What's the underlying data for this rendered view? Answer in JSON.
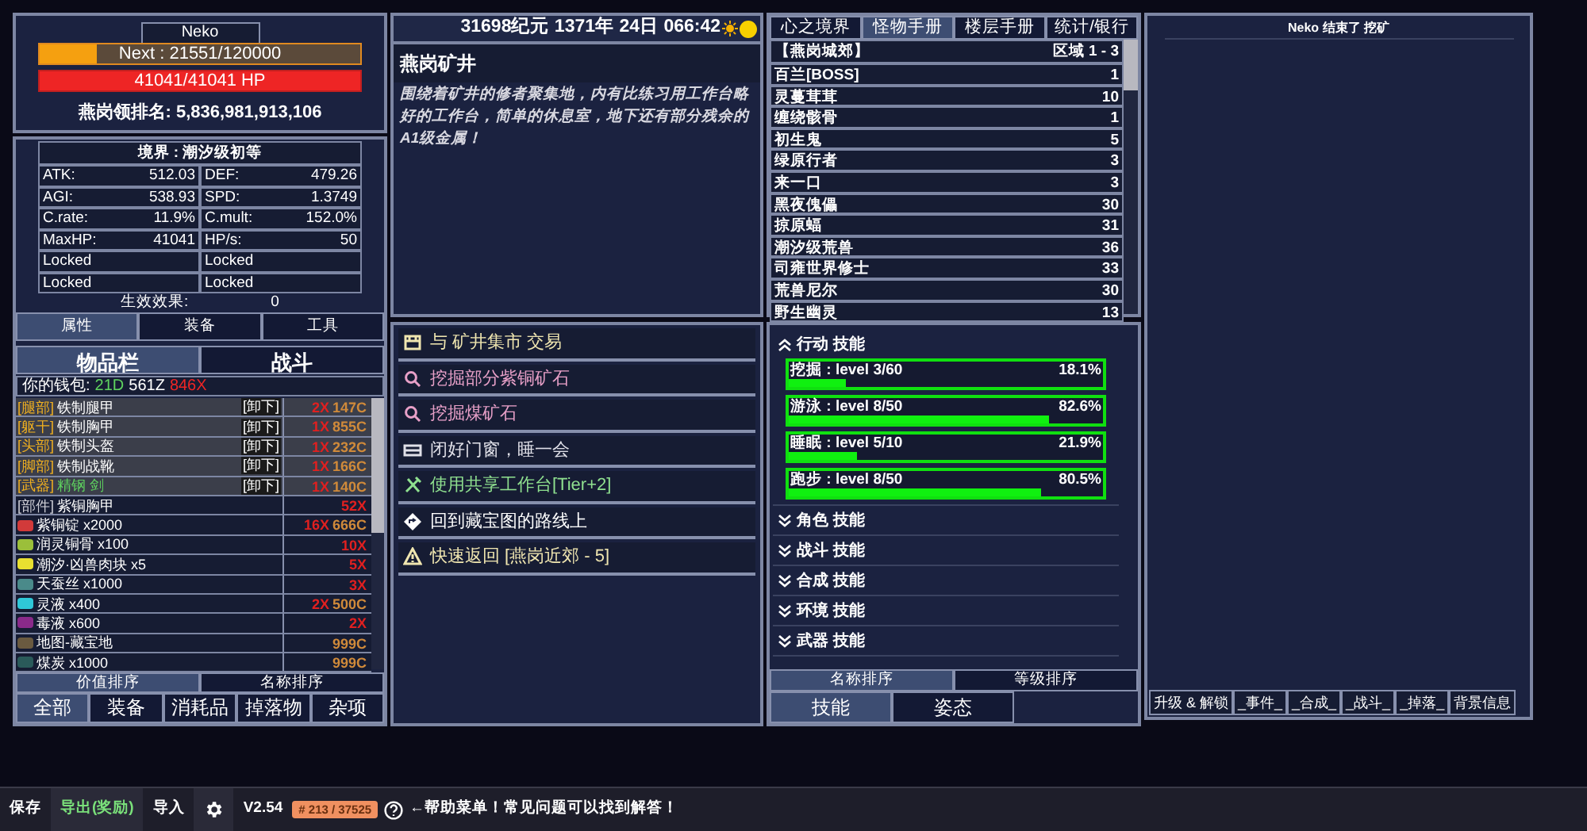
{
  "character": {
    "name": "Neko",
    "exp": {
      "text": "Next : 21551/120000",
      "level": 0.18
    },
    "hp": {
      "text": "41041/41041 HP",
      "level": 1
    },
    "rank": "燕岗领排名: 5,836,981,913,106"
  },
  "stats": {
    "realm": "境界 : 潮汐级初等",
    "cells": [
      {
        "label": "ATK:",
        "value": "512.03"
      },
      {
        "label": "DEF:",
        "value": "479.26"
      },
      {
        "label": "AGI:",
        "value": "538.93"
      },
      {
        "label": "SPD:",
        "value": "1.3749"
      },
      {
        "label": "C.rate:",
        "value": "11.9%"
      },
      {
        "label": "C.mult:",
        "value": "152.0%"
      },
      {
        "label": "MaxHP:",
        "value": "41041"
      },
      {
        "label": "HP/s:",
        "value": "50"
      },
      {
        "label": "Locked"
      },
      {
        "label": "Locked"
      },
      {
        "label": "Locked"
      },
      {
        "label": "Locked"
      }
    ],
    "effects_label": "生效效果:",
    "effects_value": "0"
  },
  "char_tabs": [
    {
      "label": "属性",
      "selected": true
    },
    {
      "label": "装备",
      "selected": false
    },
    {
      "label": "工具",
      "selected": false
    }
  ],
  "inv_tabs": [
    {
      "label": "物品栏",
      "selected": true
    },
    {
      "label": "战斗",
      "selected": false
    }
  ],
  "wallet": {
    "label": "你的钱包:",
    "d": "21D",
    "z": "561Z",
    "x": "846X"
  },
  "items": [
    {
      "kind": "equipped",
      "slot": "[腿部]",
      "name": "铁制腿甲",
      "action": "[卸下]",
      "count": "2X",
      "price": "147C"
    },
    {
      "kind": "equipped",
      "slot": "[躯干]",
      "name": "铁制胸甲",
      "action": "[卸下]",
      "count": "1X",
      "price": "855C"
    },
    {
      "kind": "equipped",
      "slot": "[头部]",
      "name": "铁制头盔",
      "action": "[卸下]",
      "count": "1X",
      "price": "232C"
    },
    {
      "kind": "equipped",
      "slot": "[脚部]",
      "name": "铁制战靴",
      "action": "[卸下]",
      "count": "1X",
      "price": "166C"
    },
    {
      "kind": "equipped",
      "slot": "[武器]",
      "name": "精钢 剑",
      "color": "#5fd35f",
      "action": "[卸下]",
      "count": "1X",
      "price": "140C"
    },
    {
      "kind": "part",
      "slot": "[部件]",
      "name": "紫铜胸甲",
      "count": "52X"
    },
    {
      "kind": "material",
      "name": "紫铜锭 x2000",
      "color": "#d23a3a",
      "count": "16X",
      "price": "666C"
    },
    {
      "kind": "material",
      "name": "润灵铜骨 x100",
      "color": "#9bbf3a",
      "count": "10X"
    },
    {
      "kind": "material",
      "name": "潮汐·凶兽肉块 x5",
      "color": "#e8e030",
      "count": "5X"
    },
    {
      "kind": "material",
      "name": "天蚕丝 x1000",
      "color": "#4a8a8a",
      "count": "3X"
    },
    {
      "kind": "material",
      "name": "灵液 x400",
      "color": "#2fc8d8",
      "count": "2X",
      "price": "500C"
    },
    {
      "kind": "material",
      "name": "毒液 x600",
      "color": "#8a2a8a",
      "count": "2X"
    },
    {
      "kind": "material",
      "name": "地图-藏宝地",
      "color": "#6a5a40",
      "price": "999C"
    },
    {
      "kind": "material",
      "name": "煤炭 x1000",
      "color": "#2a5a5a",
      "price": "999C"
    }
  ],
  "inv_sort": [
    {
      "label": "价值排序",
      "selected": true
    },
    {
      "label": "名称排序",
      "selected": false
    }
  ],
  "inv_filters": [
    {
      "label": "全部",
      "selected": true
    },
    {
      "label": "装备",
      "selected": false
    },
    {
      "label": "消耗品",
      "selected": false
    },
    {
      "label": "掉落物",
      "selected": false
    },
    {
      "label": "杂项",
      "selected": false
    }
  ],
  "clock": "31698纪元 1371年 24日 066:42",
  "location": {
    "title": "燕岗矿井",
    "description": "围绕着矿井的修者聚集地，内有比练习用工作台略好的工作台，简单的休息室，地下还有部分残余的A1级金属！"
  },
  "actions": [
    {
      "kind": "shop",
      "label": "与 矿井集市 交易",
      "color": "#f0e6b0"
    },
    {
      "kind": "search",
      "label": "挖掘部分紫铜矿石",
      "color": "#e8a0c8"
    },
    {
      "kind": "search",
      "label": "挖掘煤矿石",
      "color": "#e8a0c8"
    },
    {
      "kind": "bed",
      "label": "闭好门窗，睡一会",
      "color": "#e0e0e8"
    },
    {
      "kind": "craft",
      "label": "使用共享工作台[Tier+2]",
      "color": "#8fe08f"
    },
    {
      "kind": "travel",
      "label": "回到藏宝图的路线上",
      "color": "#ffffff"
    },
    {
      "kind": "warning",
      "label": "快速返回 [燕岗近郊 - 5]",
      "color": "#f0e6b0"
    }
  ],
  "book_tabs": [
    {
      "label": "心之境界",
      "selected": false
    },
    {
      "label": "怪物手册",
      "selected": true
    },
    {
      "label": "楼层手册",
      "selected": false
    },
    {
      "label": "统计/银行",
      "selected": false
    }
  ],
  "monsters": {
    "region": "【燕岗城郊】",
    "range": "区域 1 - 3",
    "rows": [
      {
        "name": "百兰[BOSS]",
        "count": "1"
      },
      {
        "name": "灵蔓茸茸",
        "count": "10"
      },
      {
        "name": "缠绕骸骨",
        "count": "1"
      },
      {
        "name": "初生鬼",
        "count": "5"
      },
      {
        "name": "绿原行者",
        "count": "3"
      },
      {
        "name": "来一口",
        "count": "3"
      },
      {
        "name": "黑夜傀儡",
        "count": "30"
      },
      {
        "name": "掠原蝠",
        "count": "31"
      },
      {
        "name": "潮汐级荒兽",
        "count": "36"
      },
      {
        "name": "司雍世界修士",
        "count": "33"
      },
      {
        "name": "荒兽尼尔",
        "count": "30"
      },
      {
        "name": "野生幽灵",
        "count": "13"
      }
    ]
  },
  "skill_groups": [
    {
      "label": "行动 技能",
      "expanded": true,
      "skills": [
        {
          "label": "挖掘 : level 3/60",
          "percent": "18.1%",
          "level": 0.181
        },
        {
          "label": "游泳 : level 8/50",
          "percent": "82.6%",
          "level": 0.826
        },
        {
          "label": "睡眠 : level 5/10",
          "percent": "21.9%",
          "level": 0.219
        },
        {
          "label": "跑步 : level 8/50",
          "percent": "80.5%",
          "level": 0.805
        }
      ]
    },
    {
      "label": "角色 技能",
      "expanded": false
    },
    {
      "label": "战斗 技能",
      "expanded": false
    },
    {
      "label": "合成 技能",
      "expanded": false
    },
    {
      "label": "环境 技能",
      "expanded": false
    },
    {
      "label": "武器 技能",
      "expanded": false
    }
  ],
  "skill_sort": [
    {
      "label": "名称排序",
      "selected": true
    },
    {
      "label": "等级排序",
      "selected": false
    }
  ],
  "skill_tabs": [
    {
      "label": "技能",
      "selected": true
    },
    {
      "label": "姿态",
      "selected": false
    }
  ],
  "log": [
    "Neko 结束了 挖矿"
  ],
  "log_tabs": [
    {
      "label": "升级 & 解锁"
    },
    {
      "label": "_事件_"
    },
    {
      "label": "_合成_"
    },
    {
      "label": "_战斗_"
    },
    {
      "label": "_掉落_"
    },
    {
      "label": "背景信息"
    }
  ],
  "footer": {
    "save": "保存",
    "export": "导出(奖励)",
    "import": "导入",
    "version": "V2.54",
    "counter": "# 213 / 37525",
    "help": "←帮助菜单！常见问题可以找到解答！"
  }
}
